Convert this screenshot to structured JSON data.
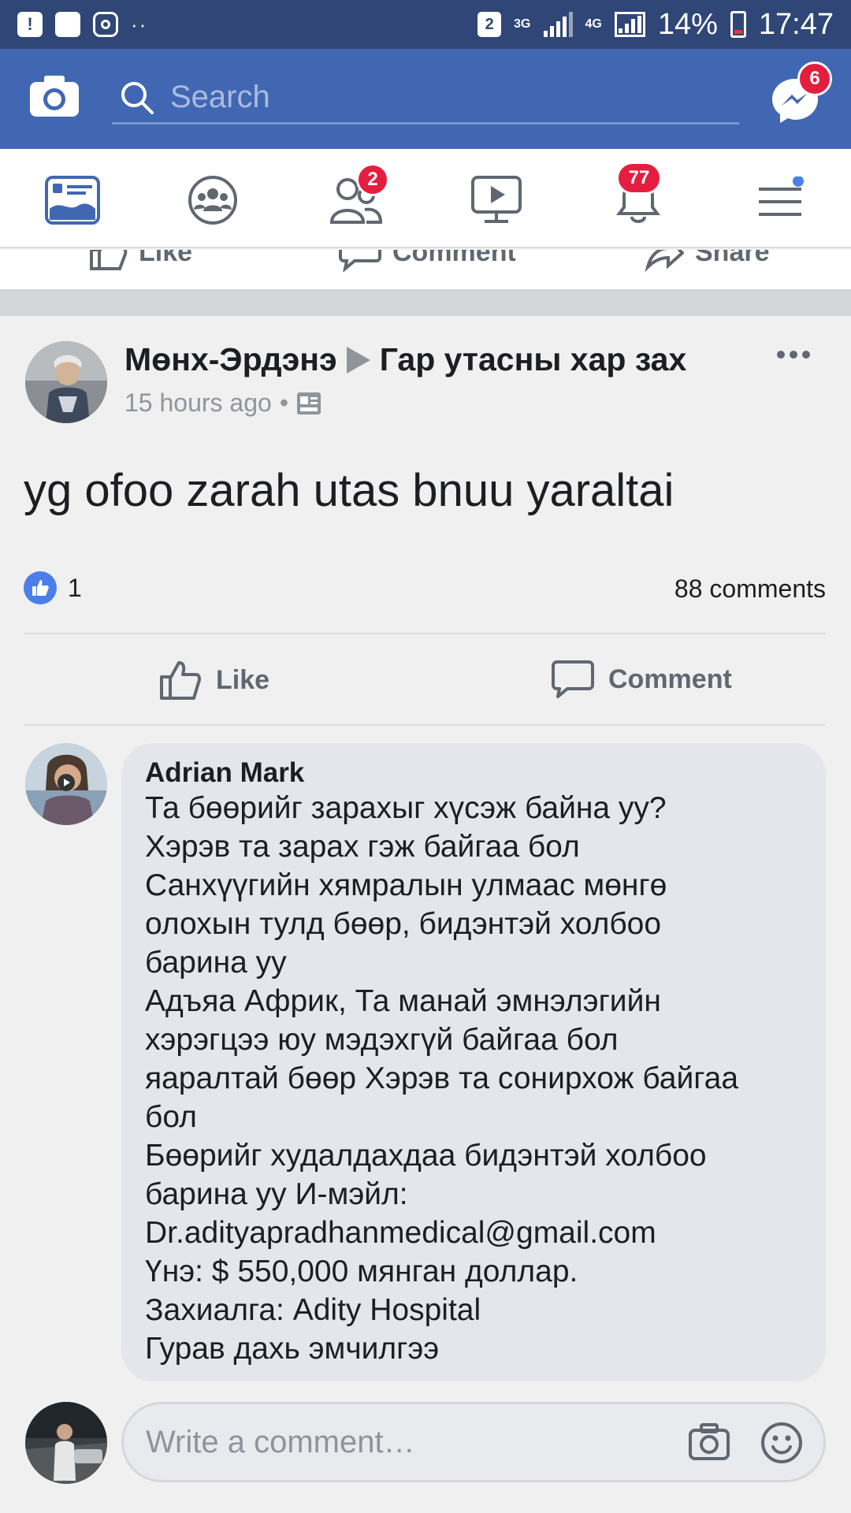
{
  "status_bar": {
    "sim_badge": "2",
    "net_3g": "3G",
    "net_4g": "4G",
    "battery_text": "14%",
    "time": "17:47"
  },
  "header": {
    "search_placeholder": "Search",
    "messenger_badge": "6"
  },
  "tabs": {
    "friends_badge": "2",
    "notifications_badge": "77"
  },
  "previous_post": {
    "like_label": "Like",
    "comment_label": "Comment",
    "share_label": "Share"
  },
  "post": {
    "author": "Мөнх-Эрдэнэ",
    "group": "Гар утасны хар зах",
    "time": "15 hours ago",
    "separator": "•",
    "text": "yg ofoo zarah utas bnuu yaraltai",
    "likes_count": "1",
    "comments_count": "88 comments",
    "like_label": "Like",
    "comment_label": "Comment"
  },
  "comment": {
    "author": "Adrian Mark",
    "lines": [
      "Та бөөрийг зарахыг хүсэж байна уу?",
      "Хэрэв та зарах гэж байгаа бол",
      "Санхүүгийн хямралын улмаас мөнгө",
      "олохын тулд бөөр, бидэнтэй холбоо",
      "барина уу",
      "Адъяа Африк, Та манай эмнэлэгийн",
      "хэрэгцээ юу мэдэхгүй байгаа бол",
      "яаралтай бөөр Хэрэв та сонирхож байгаа",
      "бол",
      "Бөөрийг худалдахдаа бидэнтэй холбоо",
      "барина уу И-мэйл:",
      "Dr.adityapradhanmedical@gmail.com",
      "Үнэ: $ 550,000 мянган доллар.",
      "Захиалга: Adity Hospital",
      "Гурав дахь эмчилгээ"
    ]
  },
  "write_comment": {
    "placeholder": "Write a comment…"
  }
}
